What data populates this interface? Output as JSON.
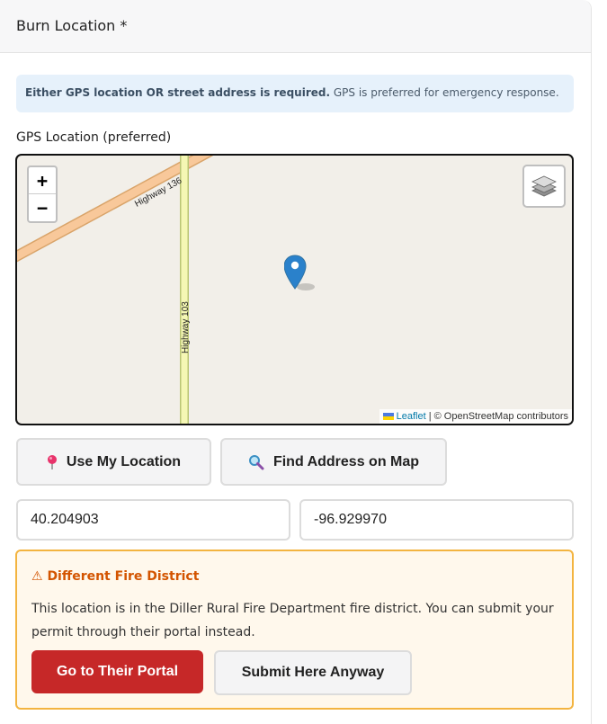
{
  "section": {
    "title": "Burn Location *"
  },
  "info": {
    "bold": "Either GPS location OR street address is required.",
    "rest": " GPS is preferred for emergency response."
  },
  "gps": {
    "label": "GPS Location (preferred)"
  },
  "map": {
    "zoom_in": "+",
    "zoom_out": "−",
    "road_1": "Highway 136",
    "road_2": "Highway 103",
    "attribution_link": "Leaflet",
    "attribution_rest": " | © OpenStreetMap contributors",
    "marker_color": "#2a81cb"
  },
  "buttons": {
    "use_location": "Use My Location",
    "find_address": "Find Address on Map"
  },
  "coords": {
    "latitude": "40.204903",
    "longitude": "-96.929970"
  },
  "warning": {
    "icon": "⚠",
    "title": "Different Fire District",
    "text": "This location is in the Diller Rural Fire Department fire district. You can submit your permit through their portal instead.",
    "portal_button": "Go to Their Portal",
    "anyway_button": "Submit Here Anyway"
  }
}
